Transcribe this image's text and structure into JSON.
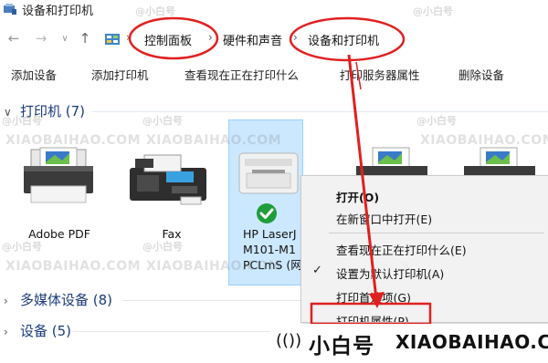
{
  "window": {
    "title": "设备和打印机"
  },
  "address": {
    "crumbs": [
      "控制面板",
      "硬件和声音",
      "设备和打印机"
    ],
    "separator": "›"
  },
  "commands": [
    "添加设备",
    "添加打印机",
    "查看现在正在打印什么",
    "打印服务器属性",
    "删除设备"
  ],
  "groups": {
    "printers": "打印机 (7)",
    "multimedia": "多媒体设备 (8)",
    "devices": "设备 (5)"
  },
  "devices": {
    "adobe": "Adobe PDF",
    "fax": "Fax",
    "hp_line1": "HP LaserJ",
    "hp_line2": "M101-M1",
    "hp_line3": "PCLmS (网"
  },
  "context_menu": [
    "打开(O)",
    "在新窗口中打开(E)",
    "查看现在正在打印什么(E)",
    "设置为默认打印机(A)",
    "打印首选项(G)",
    "打印机属性(P)"
  ],
  "watermark": {
    "handle": "@小白号",
    "domain": "XIAOBAIHAO.COM",
    "brand_signal": "(())",
    "brand_name": "小白号",
    "brand_site": "XIAOBAIHAO.COM"
  },
  "colors": {
    "annotation_red": "#e02020",
    "selection": "#cce8ff",
    "group_blue": "#1c3b7a",
    "check_green": "#1e9e3a"
  }
}
